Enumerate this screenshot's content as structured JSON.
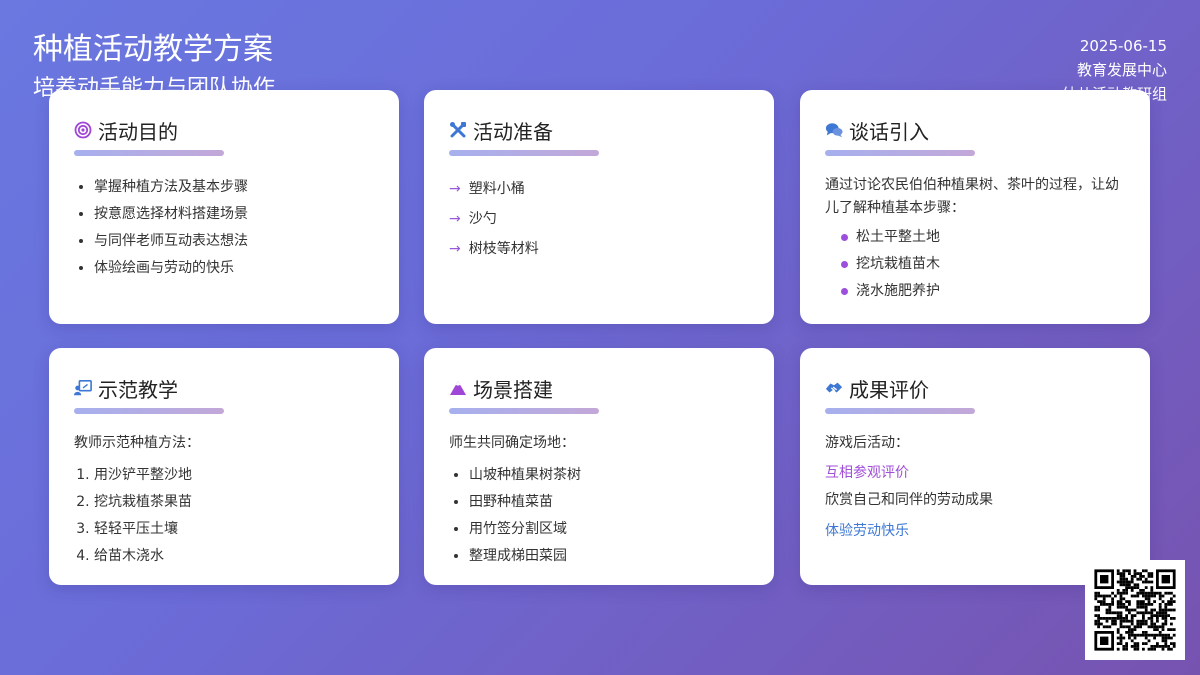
{
  "header": {
    "title": "种植活动教学方案",
    "subtitle": "培养动手能力与团队协作",
    "date": "2025-06-15",
    "org": "教育发展中心",
    "group": "幼儿活动教研组"
  },
  "colors": {
    "accent_purple": "#9b4fdc",
    "accent_blue": "#3e78d4"
  },
  "cards": {
    "goal": {
      "icon": "target-icon",
      "title": "活动目的",
      "items": [
        "掌握种植方法及基本步骤",
        "按意愿选择材料搭建场景",
        "与同伴老师互动表达想法",
        "体验绘画与劳动的快乐"
      ]
    },
    "prep": {
      "icon": "tools-icon",
      "title": "活动准备",
      "items": [
        "塑料小桶",
        "沙勺",
        "树枝等材料"
      ]
    },
    "intro": {
      "icon": "chat-icon",
      "title": "谈话引入",
      "text": "通过讨论农民伯伯种植果树、茶叶的过程，让幼儿了解种植基本步骤：",
      "items": [
        "松土平整土地",
        "挖坑栽植苗木",
        "浇水施肥养护"
      ]
    },
    "demo": {
      "icon": "teacher-icon",
      "title": "示范教学",
      "text": "教师示范种植方法：",
      "items": [
        "用沙铲平整沙地",
        "挖坑栽植茶果苗",
        "轻轻平压土壤",
        "给苗木浇水"
      ]
    },
    "scene": {
      "icon": "mountain-icon",
      "title": "场景搭建",
      "text": "师生共同确定场地：",
      "items": [
        "山坡种植果树茶树",
        "田野种植菜苗",
        "用竹签分割区域",
        "整理成梯田菜园"
      ]
    },
    "result": {
      "icon": "handshake-icon",
      "title": "成果评价",
      "text": "游戏后活动：",
      "link1": "互相参观评价",
      "line": "欣赏自己和同伴的劳动成果",
      "link2": "体验劳动快乐"
    }
  },
  "qr": {
    "icon": "qr-code-icon"
  }
}
